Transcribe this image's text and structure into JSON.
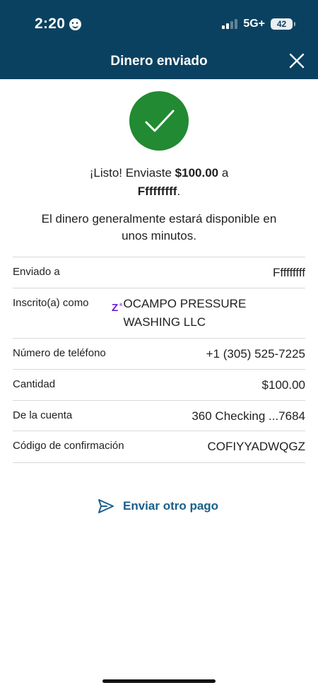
{
  "status_bar": {
    "time": "2:20",
    "network": "5G+",
    "battery": "42",
    "signal_level": "2 of 4 bars"
  },
  "header": {
    "title": "Dinero enviado",
    "close_icon": "close-icon",
    "background_color": "#0b4160"
  },
  "confirmation": {
    "icon": "checkmark-icon",
    "icon_color": "#218a32",
    "prefix": "¡Listo! Enviaste ",
    "amount": "$100.00",
    "connector": " a",
    "recipient": "Fffffffff",
    "suffix": ".",
    "availability": "El dinero generalmente estará disponible en unos minutos."
  },
  "details": [
    {
      "label": "Enviado a",
      "value": "Fffffffff"
    },
    {
      "label": "Inscrito(a) como",
      "value": "OCAMPO PRESSURE WASHING LLC",
      "icon": "zelle-icon"
    },
    {
      "label": "Número de teléfono",
      "value": "+1 (305) 525-7225"
    },
    {
      "label": "Cantidad",
      "value": "$100.00"
    },
    {
      "label": "De la cuenta",
      "value": "360 Checking ...7684"
    },
    {
      "label": "Código de confirmación",
      "value": "COFIYYADWQGZ"
    }
  ],
  "actions": {
    "send_again_label": "Enviar otro pago",
    "send_again_icon": "send-icon",
    "accent_color": "#1a5f8a"
  }
}
